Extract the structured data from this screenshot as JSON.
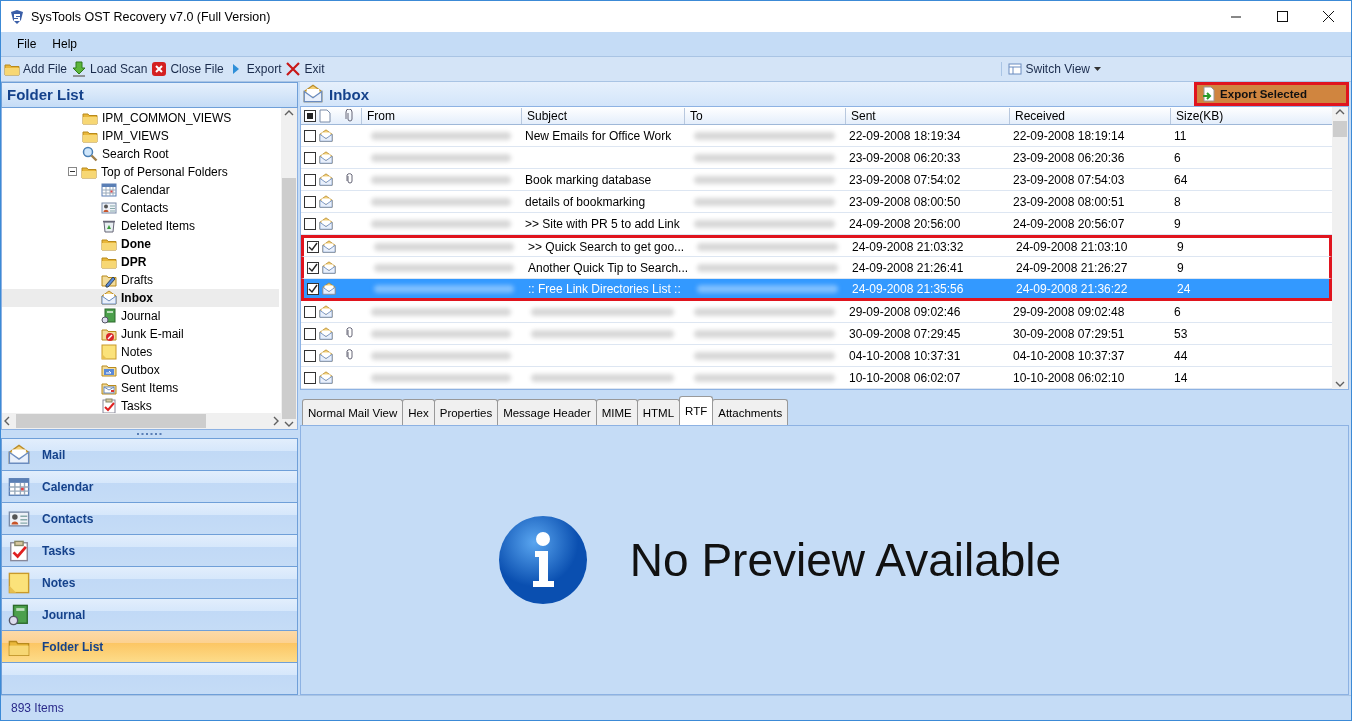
{
  "window": {
    "title": "SysTools OST Recovery v7.0 (Full Version)"
  },
  "menu": [
    "File",
    "Help"
  ],
  "toolbar": [
    {
      "label": "Add File",
      "kind": "open"
    },
    {
      "label": "Load Scan",
      "kind": "load"
    },
    {
      "label": "Close File",
      "kind": "close"
    },
    {
      "label": "Export",
      "kind": "export"
    },
    {
      "label": "Exit",
      "kind": "exit"
    }
  ],
  "switch_view": "Switch View",
  "folder_panel": {
    "title": "Folder List",
    "tree": [
      {
        "label": "IPM_COMMON_VIEWS",
        "kind": "folder",
        "bold": false,
        "selected": false
      },
      {
        "label": "IPM_VIEWS",
        "kind": "folder",
        "bold": false,
        "selected": false
      },
      {
        "label": "Search Root",
        "kind": "search",
        "bold": false,
        "selected": false
      },
      {
        "label": "Top of Personal Folders",
        "kind": "folder",
        "bold": false,
        "selected": false,
        "expanded": true,
        "children": [
          {
            "label": "Calendar",
            "kind": "calendar",
            "bold": false,
            "selected": false
          },
          {
            "label": "Contacts",
            "kind": "contacts",
            "bold": false,
            "selected": false
          },
          {
            "label": "Deleted Items",
            "kind": "deleted",
            "bold": false,
            "selected": false
          },
          {
            "label": "Done",
            "kind": "folder",
            "bold": true,
            "selected": false
          },
          {
            "label": "DPR",
            "kind": "folder",
            "bold": true,
            "selected": false
          },
          {
            "label": "Drafts",
            "kind": "drafts",
            "bold": false,
            "selected": false
          },
          {
            "label": "Inbox",
            "kind": "inbox",
            "bold": true,
            "selected": true
          },
          {
            "label": "Journal",
            "kind": "journal",
            "bold": false,
            "selected": false
          },
          {
            "label": "Junk E-mail",
            "kind": "junk",
            "bold": false,
            "selected": false
          },
          {
            "label": "Notes",
            "kind": "notes",
            "bold": false,
            "selected": false
          },
          {
            "label": "Outbox",
            "kind": "outbox",
            "bold": false,
            "selected": false
          },
          {
            "label": "Sent Items",
            "kind": "sent",
            "bold": false,
            "selected": false
          },
          {
            "label": "Tasks",
            "kind": "tasks",
            "bold": false,
            "selected": false
          }
        ]
      }
    ]
  },
  "nav": [
    {
      "label": "Mail",
      "kind": "mail",
      "selected": false
    },
    {
      "label": "Calendar",
      "kind": "calendar",
      "selected": false
    },
    {
      "label": "Contacts",
      "kind": "contacts",
      "selected": false
    },
    {
      "label": "Tasks",
      "kind": "tasks",
      "selected": false
    },
    {
      "label": "Notes",
      "kind": "notes",
      "selected": false
    },
    {
      "label": "Journal",
      "kind": "journal",
      "selected": false
    },
    {
      "label": "Folder List",
      "kind": "folder",
      "selected": true
    }
  ],
  "status_bar": "893 Items",
  "mail_list": {
    "title": "Inbox",
    "export_button": {
      "label": "Export Selected",
      "outlined": true
    },
    "select_all_partial": true,
    "columns": [
      "From",
      "Subject",
      "To",
      "Sent",
      "Received",
      "Size(KB)"
    ],
    "rows": [
      {
        "checked": false,
        "selected": false,
        "outlined": false,
        "attachment": false,
        "subject": "New Emails for Office Work",
        "sent": "22-09-2008 18:19:34",
        "received": "22-09-2008 18:19:14",
        "size": "11"
      },
      {
        "checked": false,
        "selected": false,
        "outlined": false,
        "attachment": false,
        "sent": "23-09-2008 06:20:33",
        "received": "23-09-2008 06:20:36",
        "size": "6"
      },
      {
        "checked": false,
        "selected": false,
        "outlined": false,
        "attachment": true,
        "subject": "Book marking database",
        "sent": "23-09-2008 07:54:02",
        "received": "23-09-2008 07:54:03",
        "size": "64"
      },
      {
        "checked": false,
        "selected": false,
        "outlined": false,
        "attachment": false,
        "subject": "details of bookmarking",
        "sent": "23-09-2008 08:00:50",
        "received": "23-09-2008 08:00:51",
        "size": "8"
      },
      {
        "checked": false,
        "selected": false,
        "outlined": false,
        "attachment": false,
        "subject": ">> Site with PR 5 to add Link",
        "sent": "24-09-2008 20:56:00",
        "received": "24-09-2008 20:56:07",
        "size": "9"
      },
      {
        "checked": true,
        "selected": false,
        "outlined": true,
        "attachment": false,
        "subject": ">> Quick Search to get goo...",
        "sent": "24-09-2008 21:03:32",
        "received": "24-09-2008 21:03:10",
        "size": "9"
      },
      {
        "checked": true,
        "selected": false,
        "outlined": true,
        "attachment": false,
        "subject": "Another Quick Tip to Search...",
        "sent": "24-09-2008 21:26:41",
        "received": "24-09-2008 21:26:27",
        "size": "9"
      },
      {
        "checked": true,
        "selected": true,
        "outlined": true,
        "attachment": false,
        "subject": ":: Free Link Directories List ::",
        "sent": "24-09-2008 21:35:56",
        "received": "24-09-2008 21:36:22",
        "size": "24"
      },
      {
        "checked": false,
        "selected": false,
        "outlined": false,
        "attachment": false,
        "subject_hidden": true,
        "sent": "29-09-2008 09:02:46",
        "received": "29-09-2008 09:02:48",
        "size": "6"
      },
      {
        "checked": false,
        "selected": false,
        "outlined": false,
        "attachment": true,
        "subject_hidden": true,
        "sent": "30-09-2008 07:29:45",
        "received": "30-09-2008 07:29:51",
        "size": "53"
      },
      {
        "checked": false,
        "selected": false,
        "outlined": false,
        "attachment": true,
        "sent": "04-10-2008 10:37:31",
        "received": "04-10-2008 10:37:37",
        "size": "44"
      },
      {
        "checked": false,
        "selected": false,
        "outlined": false,
        "attachment": false,
        "subject_hidden": true,
        "sent": "10-10-2008 06:02:07",
        "received": "10-10-2008 06:02:10",
        "size": "14"
      }
    ]
  },
  "preview_tabs": [
    {
      "label": "Normal Mail View",
      "selected": false
    },
    {
      "label": "Hex",
      "selected": false
    },
    {
      "label": "Properties",
      "selected": false
    },
    {
      "label": "Message Header",
      "selected": false
    },
    {
      "label": "MIME",
      "selected": false
    },
    {
      "label": "HTML",
      "selected": false
    },
    {
      "label": "RTF",
      "selected": true
    },
    {
      "label": "Attachments",
      "selected": false
    }
  ],
  "preview": {
    "message": "No Preview Available"
  }
}
